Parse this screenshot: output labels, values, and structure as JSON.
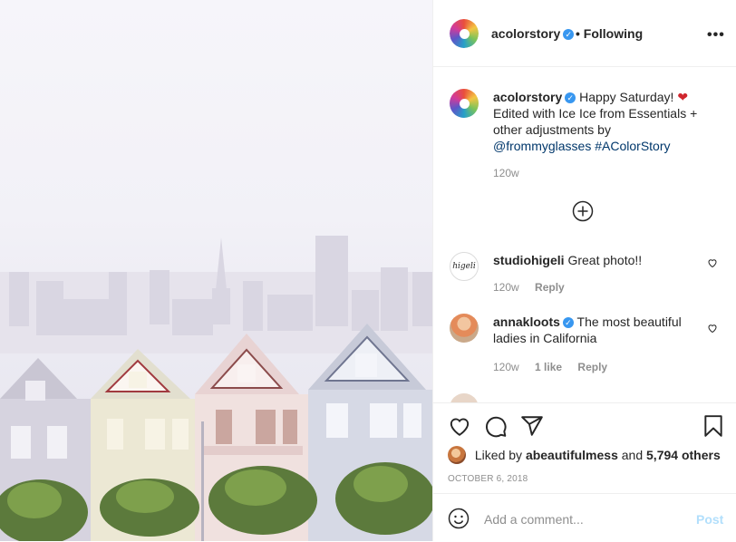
{
  "post": {
    "username": "acolorstory",
    "separator": "•",
    "follow_status": "Following",
    "more": "•••"
  },
  "caption": {
    "username": "acolorstory",
    "text_1": "Happy Saturday!",
    "text_2": "Edited with Ice Ice from Essentials  + other adjustments by",
    "mention": "@frommyglasses",
    "hashtag": "#AColorStory",
    "age": "120w"
  },
  "comments": [
    {
      "username": "studiohigeli",
      "text": "Great photo!!",
      "age": "120w",
      "likes": "",
      "reply": "Reply",
      "avatar_text": "higeli"
    },
    {
      "username": "annakloots",
      "text": "The most beautiful ladies in California",
      "age": "120w",
      "likes": "1 like",
      "reply": "Reply"
    }
  ],
  "icons": [
    "verified-icon",
    "heart-emoji-icon",
    "load-more-icon",
    "like-icon",
    "comment-icon",
    "share-icon",
    "save-icon",
    "emoji-icon"
  ],
  "likes": {
    "prefix": "Liked by",
    "liker": "abeautifulmess",
    "connector": "and",
    "count": "5,794 others"
  },
  "date": "OCTOBER 6, 2018",
  "compose": {
    "placeholder": "Add a comment...",
    "post_label": "Post"
  },
  "colors": {
    "link": "#00376b",
    "verified": "#3897f0",
    "post_disabled": "#b2dffc",
    "meta": "#8e8e8e"
  }
}
